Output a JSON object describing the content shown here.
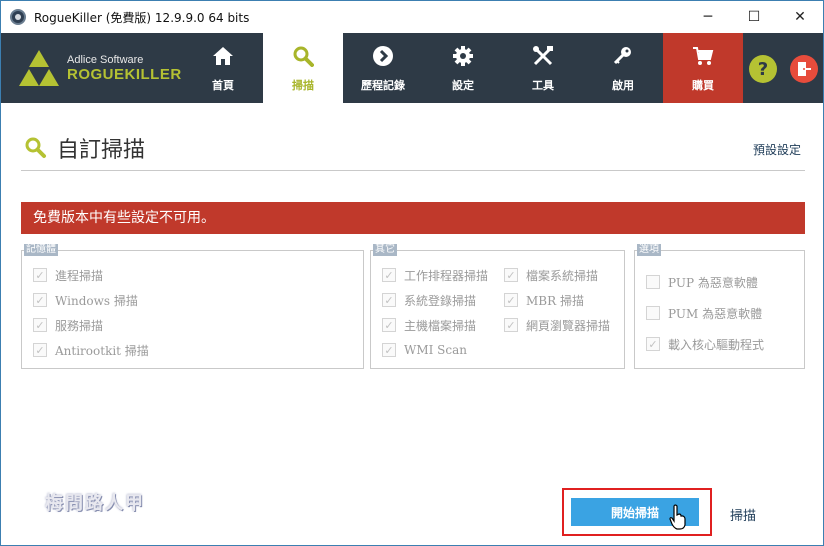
{
  "window": {
    "title": "RogueKiller (免費版) 12.9.9.0 64 bits",
    "controls": {
      "minimize": "─",
      "maximize": "☐",
      "close": "✕"
    }
  },
  "brand": {
    "company": "Adlice Software",
    "product": "ROGUEKILLER"
  },
  "nav": {
    "tabs": [
      {
        "label": "首頁",
        "icon": "home-icon"
      },
      {
        "label": "掃描",
        "icon": "search-icon",
        "active": true
      },
      {
        "label": "歷程記錄",
        "icon": "chevron-right-icon"
      },
      {
        "label": "設定",
        "icon": "gear-icon"
      },
      {
        "label": "工具",
        "icon": "tools-icon"
      },
      {
        "label": "啟用",
        "icon": "key-icon"
      },
      {
        "label": "購買",
        "icon": "cart-icon"
      }
    ],
    "help": "?",
    "exit": "exit-icon"
  },
  "page": {
    "title": "自訂掃描",
    "defaults_link": "預設設定",
    "warning": "免費版本中有些設定不可用。"
  },
  "groups": {
    "memory": {
      "title": "記憶體",
      "items": [
        "進程掃描",
        "Windows 掃描",
        "服務掃描",
        "Antirootkit 掃描"
      ]
    },
    "other": {
      "title": "其它",
      "items": [
        "工作排程器掃描",
        "系統登錄掃描",
        "主機檔案掃描",
        "WMI Scan",
        "檔案系統掃描",
        "MBR 掃描",
        "網頁瀏覽器掃描"
      ]
    },
    "options": {
      "title": "選項",
      "items": [
        {
          "label": "PUP 為惡意軟體",
          "checked": false
        },
        {
          "label": "PUM 為惡意軟體",
          "checked": false
        },
        {
          "label": "載入核心驅動程式",
          "checked": true
        }
      ]
    }
  },
  "footer": {
    "watermark": "梅問路人甲",
    "start_button": "開始掃描",
    "scan_link": "掃描"
  },
  "colors": {
    "nav_bg": "#2e3a46",
    "accent": "#b5c233",
    "buy": "#c0392b",
    "warning": "#c0392b",
    "start": "#3aa3e3"
  }
}
